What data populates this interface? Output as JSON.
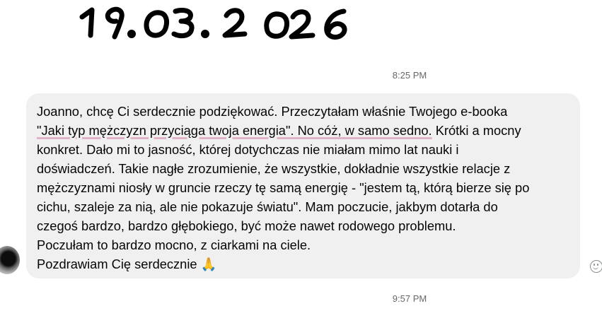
{
  "handwritten_date": "19.03.2026",
  "timestamps": {
    "first": "8:25 PM",
    "second": "9:57 PM"
  },
  "message": {
    "line1": "Joanno, chcę Ci serdecznie podziękować. Przeczytałam właśnie Twojego e-booka",
    "line2_highlight": "\"Jaki typ mężczyzn przyciąga twoja energia\". No cóż, w samo sedno.",
    "line2_rest": " Krótki a mocny",
    "line3": "konkret. Dało mi to jasność, której dotychczas nie miałam mimo lat nauki i",
    "line4": "doświadczeń. Takie nagłe zrozumienie, że wszystkie, dokładnie wszystkie relacje z",
    "line5": "mężczyznami niosły w gruncie rzeczy tę samą energię - \"jestem tą, którą bierze się po",
    "line6": "cichu, szaleje za nią, ale nie pokazuje światu\".  Mam poczucie, jakbym dotarła do",
    "line7": "czegoś bardzo, bardzo głębokiego, być może nawet rodowego problemu.",
    "line8": "Poczułam to bardzo mocno, z ciarkami na ciele.",
    "line9_text": "Pozdrawiam Cię serdecznie ",
    "line9_emoji": "🙏"
  },
  "icons": {
    "avatar": "avatar",
    "emoji_reaction": "smiley-face-icon"
  },
  "colors": {
    "bubble_bg": "#f0f0f0",
    "timestamp_text": "#65676b",
    "highlight_underline": "#d682aa"
  }
}
